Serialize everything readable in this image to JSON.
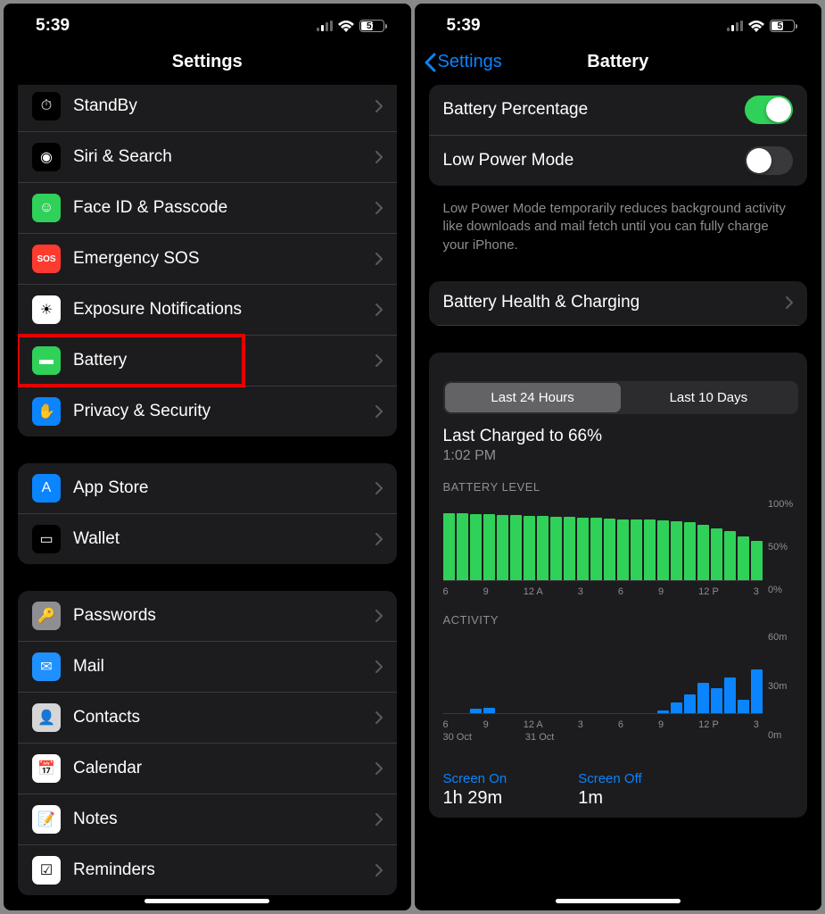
{
  "status": {
    "time": "5:39",
    "battery_pct": "51",
    "battery_fill_pct": 51
  },
  "left": {
    "title": "Settings",
    "groups": [
      {
        "clipped_top": true,
        "items": [
          {
            "id": "standby",
            "label": "StandBy",
            "icon_bg": "#000",
            "glyph": "⏱"
          },
          {
            "id": "siri",
            "label": "Siri & Search",
            "icon_bg": "#000",
            "glyph": "◉"
          },
          {
            "id": "faceid",
            "label": "Face ID & Passcode",
            "icon_bg": "#30d158",
            "glyph": "☺"
          },
          {
            "id": "sos",
            "label": "Emergency SOS",
            "icon_bg": "#ff3b30",
            "glyph": "SOS"
          },
          {
            "id": "exposure",
            "label": "Exposure Notifications",
            "icon_bg": "#fff",
            "glyph": "☀"
          },
          {
            "id": "battery",
            "label": "Battery",
            "icon_bg": "#30d158",
            "glyph": "▬",
            "highlight": true
          },
          {
            "id": "privacy",
            "label": "Privacy & Security",
            "icon_bg": "#0a84ff",
            "glyph": "✋"
          }
        ]
      },
      {
        "items": [
          {
            "id": "appstore",
            "label": "App Store",
            "icon_bg": "#0a84ff",
            "glyph": "A"
          },
          {
            "id": "wallet",
            "label": "Wallet",
            "icon_bg": "#000",
            "glyph": "▭"
          }
        ]
      },
      {
        "items": [
          {
            "id": "passwords",
            "label": "Passwords",
            "icon_bg": "#8e8e93",
            "glyph": "🔑"
          },
          {
            "id": "mail",
            "label": "Mail",
            "icon_bg": "#1e90ff",
            "glyph": "✉"
          },
          {
            "id": "contacts",
            "label": "Contacts",
            "icon_bg": "#d6d6d6",
            "glyph": "👤"
          },
          {
            "id": "calendar",
            "label": "Calendar",
            "icon_bg": "#fff",
            "glyph": "📅"
          },
          {
            "id": "notes",
            "label": "Notes",
            "icon_bg": "#fff",
            "glyph": "📝"
          },
          {
            "id": "reminders",
            "label": "Reminders",
            "icon_bg": "#fff",
            "glyph": "☑"
          }
        ]
      }
    ]
  },
  "right": {
    "back": "Settings",
    "title": "Battery",
    "toggles": [
      {
        "id": "pct",
        "label": "Battery Percentage",
        "on": true
      },
      {
        "id": "lpm",
        "label": "Low Power Mode",
        "on": false
      }
    ],
    "lpm_footer": "Low Power Mode temporarily reduces background activity like downloads and mail fetch until you can fully charge your iPhone.",
    "health_label": "Battery Health & Charging",
    "segments": [
      "Last 24 Hours",
      "Last 10 Days"
    ],
    "active_segment": 0,
    "last_charged_label": "Last Charged to 66%",
    "last_charged_time": "1:02 PM",
    "battery_level_label": "BATTERY LEVEL",
    "activity_label": "ACTIVITY",
    "screen_on_label": "Screen On",
    "screen_on_value": "1h 29m",
    "screen_off_label": "Screen Off",
    "screen_off_value": "1m",
    "x_ticks": [
      "6",
      "9",
      "12 A",
      "3",
      "6",
      "9",
      "12 P",
      "3"
    ],
    "x_dates": [
      "30 Oct",
      "31 Oct"
    ],
    "y_level": [
      "100%",
      "50%",
      "0%"
    ],
    "y_activity": [
      "60m",
      "30m",
      "0m"
    ]
  },
  "chart_data": {
    "type": "bar",
    "battery_level": {
      "title": "BATTERY LEVEL",
      "ylabel": "%",
      "ylim": [
        0,
        100
      ],
      "x": [
        "6",
        "",
        "",
        "9",
        "",
        "",
        "12A",
        "",
        "",
        "3",
        "",
        "",
        "6",
        "",
        "",
        "9",
        "",
        "",
        "12P",
        "",
        "",
        "3",
        "",
        ""
      ],
      "values": [
        82,
        82,
        81,
        81,
        80,
        80,
        79,
        79,
        78,
        78,
        77,
        77,
        76,
        75,
        75,
        74,
        73,
        72,
        71,
        68,
        64,
        60,
        54,
        48
      ]
    },
    "activity": {
      "title": "ACTIVITY",
      "ylabel": "minutes",
      "ylim": [
        0,
        60
      ],
      "x": [
        "6",
        "",
        "",
        "9",
        "",
        "",
        "12A",
        "",
        "",
        "3",
        "",
        "",
        "6",
        "",
        "",
        "9",
        "",
        "",
        "12P",
        "",
        "",
        "3",
        "",
        ""
      ],
      "values": [
        0,
        0,
        3,
        4,
        0,
        0,
        0,
        0,
        0,
        0,
        0,
        0,
        0,
        0,
        0,
        0,
        2,
        8,
        14,
        22,
        18,
        26,
        10,
        32
      ]
    }
  }
}
